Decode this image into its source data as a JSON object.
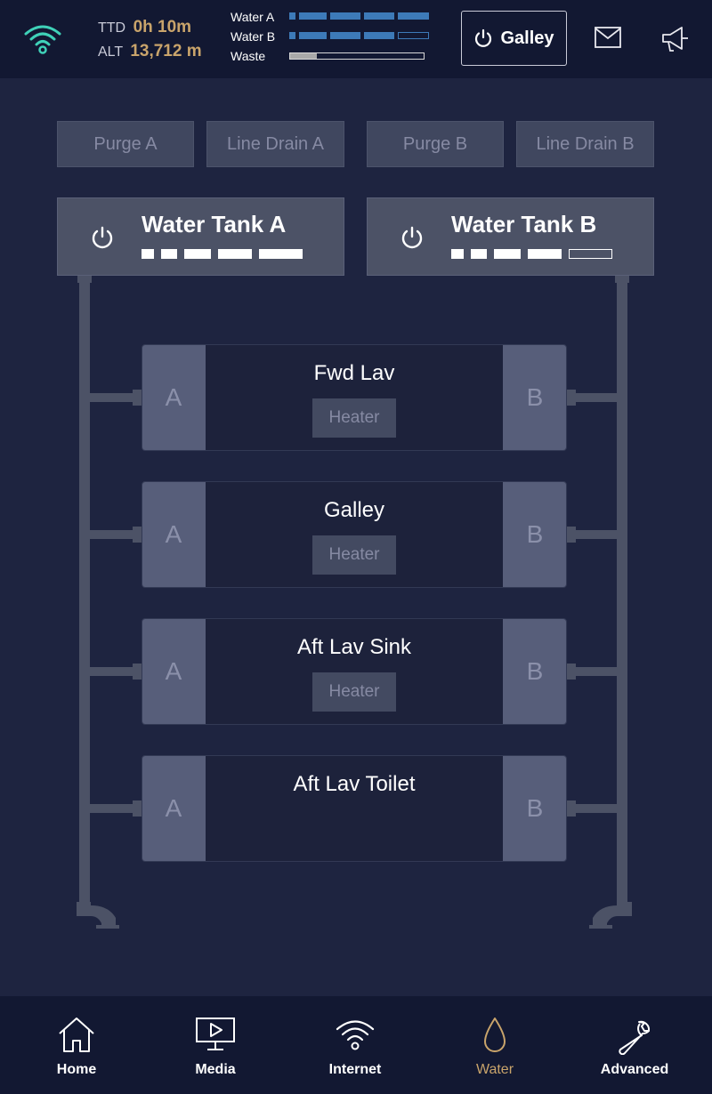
{
  "status": {
    "ttd_label": "TTD",
    "ttd_value": "0h 10m",
    "alt_label": "ALT",
    "alt_value": "13,712 m",
    "levels": {
      "water_a_label": "Water A",
      "water_a_filled_segments": 5,
      "water_a_total_segments": 5,
      "water_b_label": "Water B",
      "water_b_filled_segments": 4,
      "water_b_total_segments": 5,
      "waste_label": "Waste",
      "waste_fraction": 0.2
    },
    "galley_button_label": "Galley",
    "wifi_icon": "wifi-icon",
    "mail_icon": "mail-icon",
    "announce_icon": "megaphone-icon"
  },
  "actions": {
    "purge_a": "Purge A",
    "line_drain_a": "Line Drain A",
    "purge_b": "Purge B",
    "line_drain_b": "Line Drain B"
  },
  "tanks": {
    "a": {
      "title": "Water Tank A",
      "filled_segments": 5,
      "total_segments": 5
    },
    "b": {
      "title": "Water Tank B",
      "filled_segments": 4,
      "total_segments": 5
    }
  },
  "outlets": [
    {
      "title": "Fwd Lav",
      "side_a": "A",
      "side_b": "B",
      "heater": "Heater"
    },
    {
      "title": "Galley",
      "side_a": "A",
      "side_b": "B",
      "heater": "Heater"
    },
    {
      "title": "Aft Lav Sink",
      "side_a": "A",
      "side_b": "B",
      "heater": "Heater"
    },
    {
      "title": "Aft Lav Toilet",
      "side_a": "A",
      "side_b": "B"
    }
  ],
  "nav": {
    "home": "Home",
    "media": "Media",
    "internet": "Internet",
    "water": "Water",
    "advanced": "Advanced",
    "active": "water"
  },
  "colors": {
    "accent": "#c9a46b",
    "wifi": "#3fd1b8",
    "level_bar": "#3d7ab8",
    "background": "#1e2440",
    "bar_background": "#121832"
  }
}
